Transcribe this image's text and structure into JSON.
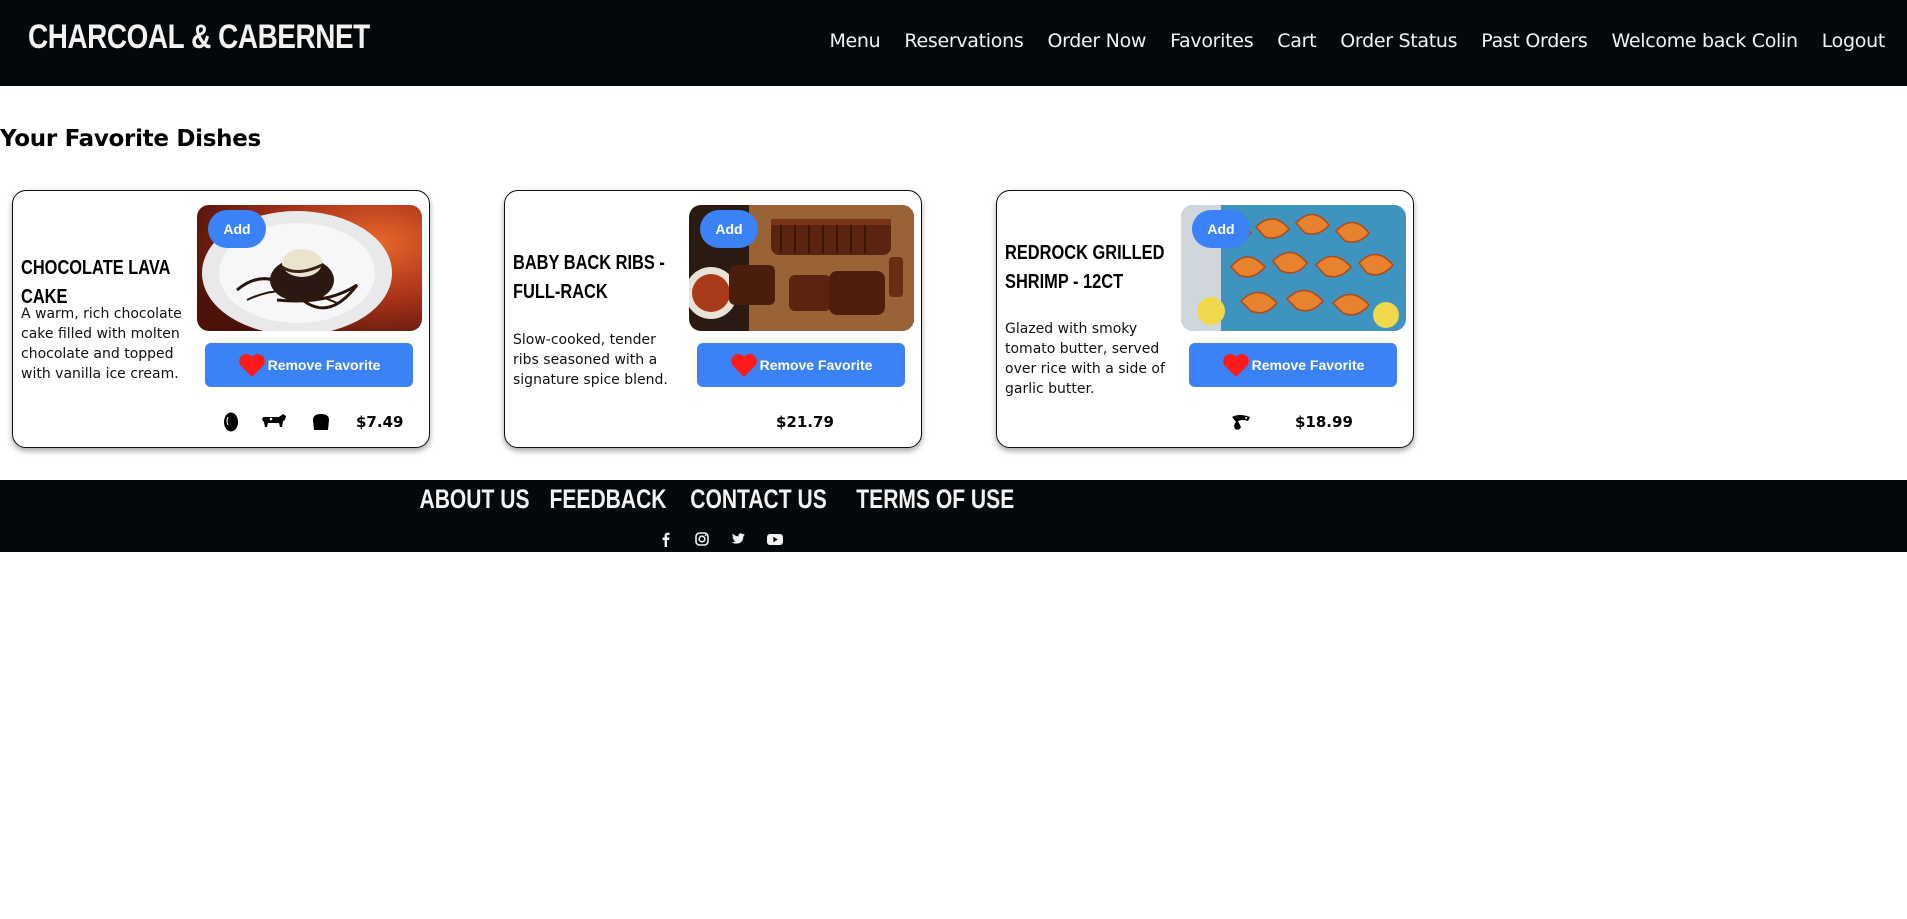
{
  "header": {
    "brand": "CHARCOAL & CABERNET",
    "nav": [
      "Menu",
      "Reservations",
      "Order Now",
      "Favorites",
      "Cart",
      "Order Status",
      "Past Orders",
      "Welcome back Colin",
      "Logout"
    ]
  },
  "page_title": "Your Favorite Dishes",
  "cards": [
    {
      "name": "Chocolate Lava Cake",
      "description": "A warm, rich chocolate cake filled with molten chocolate and topped with vanilla ice cream.",
      "price": "$7.49",
      "add_label": "Add",
      "remove_label": "Remove Favorite",
      "icons": [
        "egg-icon",
        "dairy-cow-icon",
        "gluten-bread-icon"
      ]
    },
    {
      "name": "Baby Back Ribs - Full-Rack",
      "description": "Slow-cooked, tender ribs seasoned with a signature spice blend.",
      "price": "$21.79",
      "add_label": "Add",
      "remove_label": "Remove Favorite",
      "icons": []
    },
    {
      "name": "Redrock Grilled Shrimp - 12ct",
      "description": "Glazed with smoky tomato butter, served over rice with a side of garlic butter.",
      "price": "$18.99",
      "add_label": "Add",
      "remove_label": "Remove Favorite",
      "icons": [
        "shellfish-icon"
      ]
    }
  ],
  "footer": {
    "links": [
      "ABOUT US",
      "FEEDBACK",
      "CONTACT US",
      "TERMS OF USE"
    ],
    "socials": [
      "facebook-icon",
      "instagram-icon",
      "twitter-icon",
      "youtube-icon"
    ]
  },
  "colors": {
    "header_bg": "#05080b",
    "accent_blue": "#3b82f6",
    "heart_red": "#ff1a1a"
  }
}
